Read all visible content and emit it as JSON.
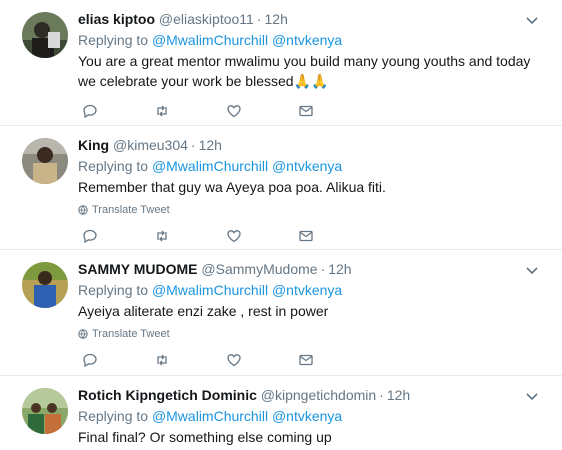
{
  "tweets": [
    {
      "name": "elias kiptoo",
      "handle": "@eliaskiptoo11",
      "time": "12h",
      "replying_prefix": "Replying to",
      "mentions": [
        "@MwalimChurchill",
        "@ntvkenya"
      ],
      "text": "You are a great mentor mwalimu you build many young youths and today we celebrate your work be blessed",
      "emoji": "🙏🙏",
      "translate": ""
    },
    {
      "name": "King",
      "handle": "@kimeu304",
      "time": "12h",
      "replying_prefix": "Replying to",
      "mentions": [
        "@MwalimChurchill",
        "@ntvkenya"
      ],
      "text": "Remember that guy wa Ayeya poa poa. Alikua fiti.",
      "emoji": "",
      "translate": "Translate Tweet"
    },
    {
      "name": "SAMMY MUDOME",
      "handle": "@SammyMudome",
      "time": "12h",
      "replying_prefix": "Replying to",
      "mentions": [
        "@MwalimChurchill",
        "@ntvkenya"
      ],
      "text": "Ayeiya aliterate enzi zake , rest in power",
      "emoji": "",
      "translate": "Translate Tweet"
    },
    {
      "name": "Rotich Kipngetich Dominic",
      "handle": "@kipngetichdomin",
      "time": "12h",
      "replying_prefix": "Replying to",
      "mentions": [
        "@MwalimChurchill",
        "@ntvkenya"
      ],
      "text": "Final final? Or something else coming up",
      "emoji": "",
      "translate": ""
    }
  ],
  "icons": {
    "reply": "reply-icon",
    "retweet": "retweet-icon",
    "like": "like-icon",
    "message": "message-icon",
    "caret": "chevron-down-icon",
    "globe": "globe-icon"
  },
  "colors": {
    "link": "#1b95e0",
    "muted": "#657786",
    "text": "#14171a",
    "divider": "#e6ecf0"
  }
}
